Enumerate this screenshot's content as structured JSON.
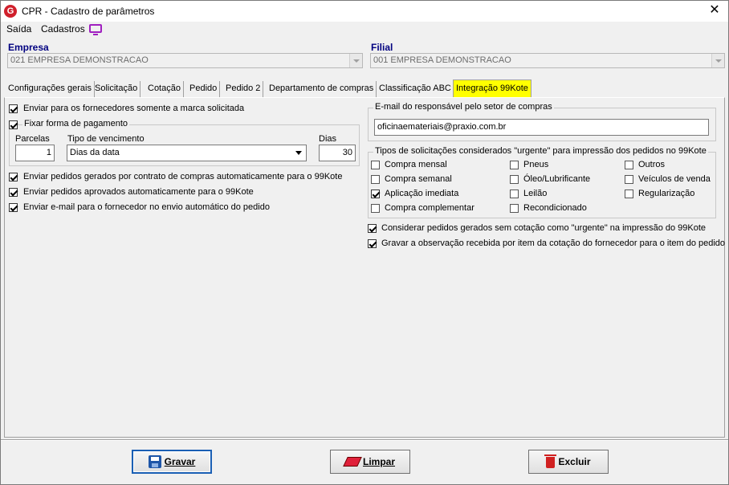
{
  "window": {
    "title": "CPR - Cadastro de parâmetros",
    "app_icon": "G",
    "close_glyph": "✕"
  },
  "menu": {
    "saida": "Saída",
    "cadastros": "Cadastros"
  },
  "empresa": {
    "label": "Empresa",
    "value": "021 EMPRESA DEMONSTRACAO"
  },
  "filial": {
    "label": "Filial",
    "value": "001 EMPRESA DEMONSTRACAO"
  },
  "tabs": [
    "Configurações gerais",
    "Solicitação",
    "Cotação",
    "Pedido",
    "Pedido 2",
    "Departamento de compras",
    "Classificação ABC",
    "Integração 99Kote"
  ],
  "left": {
    "enviar_marca": {
      "label": "Enviar para os fornecedores somente a marca solicitada",
      "checked": true
    },
    "fixar_pagamento": {
      "label": "Fixar forma de pagamento",
      "checked": true
    },
    "parcelas_label": "Parcelas",
    "parcelas_value": "1",
    "tipo_venc_label": "Tipo de vencimento",
    "tipo_venc_value": "Dias da data",
    "dias_label": "Dias",
    "dias_value": "30",
    "enviar_contrato": {
      "label": "Enviar pedidos gerados por contrato de compras automaticamente para o 99Kote",
      "checked": true
    },
    "enviar_aprovados": {
      "label": "Enviar pedidos aprovados automaticamente para o 99Kote",
      "checked": true
    },
    "enviar_email": {
      "label": "Enviar e-mail para o fornecedor no envio automático do pedido",
      "checked": true
    }
  },
  "right": {
    "email_legend": "E-mail do responsável pelo setor de compras",
    "email_value": "oficinaemateriais@praxio.com.br",
    "tipos_legend": "Tipos de solicitações considerados \"urgente\" para impressão dos pedidos no 99Kote",
    "tipos": [
      {
        "label": "Compra mensal",
        "checked": false
      },
      {
        "label": "Pneus",
        "checked": false
      },
      {
        "label": "Outros",
        "checked": false
      },
      {
        "label": "Compra semanal",
        "checked": false
      },
      {
        "label": "Óleo/Lubrificante",
        "checked": false
      },
      {
        "label": "Veículos de venda",
        "checked": false
      },
      {
        "label": "Aplicação imediata",
        "checked": true
      },
      {
        "label": "Leilão",
        "checked": false
      },
      {
        "label": "Regularização",
        "checked": false
      },
      {
        "label": "Compra complementar",
        "checked": false
      },
      {
        "label": "Recondicionado",
        "checked": false
      }
    ],
    "considerar": {
      "label": "Considerar pedidos gerados sem cotação como \"urgente\" na impressão do 99Kote",
      "checked": true
    },
    "gravar_obs": {
      "label": "Gravar a observação recebida por item da cotação do fornecedor para o item do pedido",
      "checked": true
    }
  },
  "buttons": {
    "gravar": "Gravar",
    "limpar": "Limpar",
    "excluir": "Excluir"
  }
}
